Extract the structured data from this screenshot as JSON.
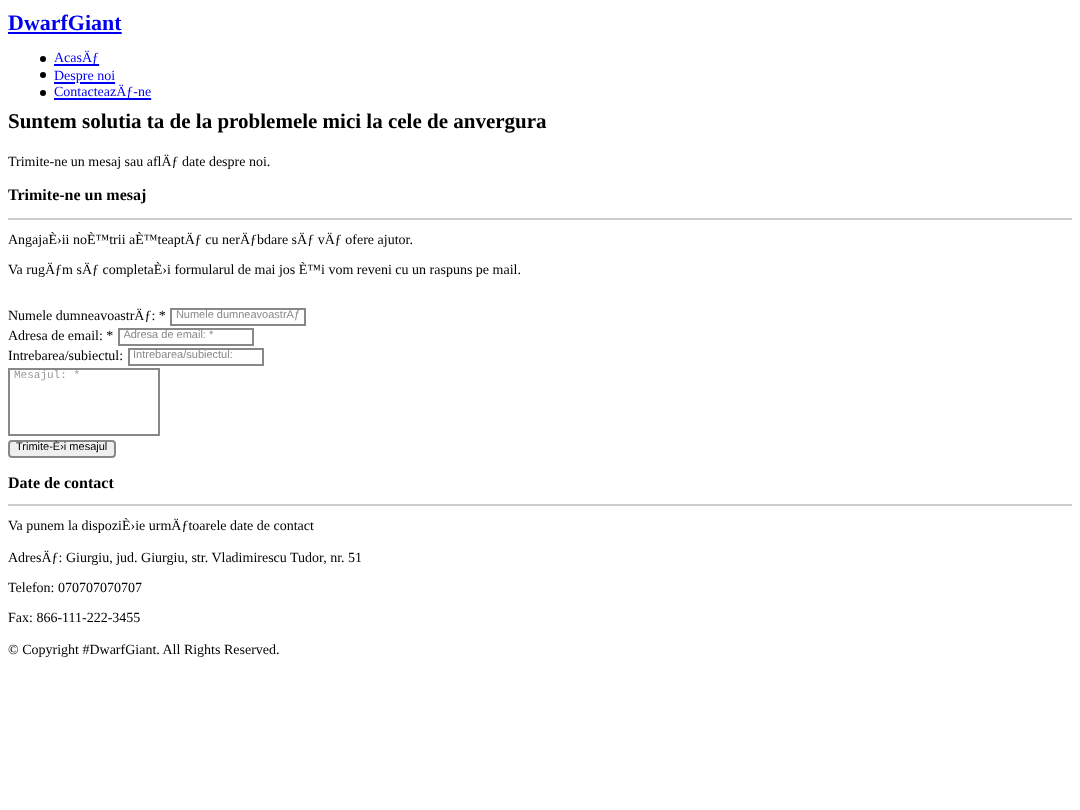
{
  "site_title": "DwarfGiant",
  "nav": [
    {
      "label": "AcasÄƒ"
    },
    {
      "label": "Despre noi"
    },
    {
      "label": "ContacteazÄƒ-ne"
    }
  ],
  "headline": "Suntem solutia ta de la problemele mici la cele de anvergura",
  "intro": "Trimite-ne un mesaj sau aflÄƒ date despre noi.",
  "message_section": {
    "heading": "Trimite-ne un mesaj",
    "paragraphs": [
      "AngajaÈ›ii noÈ™trii aÈ™teaptÄƒ cu nerÄƒbdare sÄƒ vÄƒ ofere ajutor.",
      "Va rugÄƒm sÄƒ completaÈ›i formularul de mai jos È™i vom reveni cu un raspuns pe mail."
    ]
  },
  "form": {
    "fields": [
      {
        "kind": "text",
        "label": "Numele dumneavoastrÄƒ: *",
        "placeholder": "Numele dumneavoastrÄƒ"
      },
      {
        "kind": "text",
        "label": "Adresa de email: *",
        "placeholder": "Adresa de email: *"
      },
      {
        "kind": "text",
        "label": "Intrebarea/subiectul:",
        "placeholder": "Intrebarea/subiectul:"
      },
      {
        "kind": "textarea",
        "placeholder": "Mesajul: *"
      }
    ],
    "submit": "Trimite-È›i mesajul"
  },
  "contact_section": {
    "heading": "Date de contact",
    "lines": [
      "Va punem la dispoziÈ›ie urmÄƒtoarele date de contact",
      "AdresÄƒ: Giurgiu, jud. Giurgiu, str. Vladimirescu Tudor, nr. 51",
      "Telefon: 070707070707",
      "Fax: 866-111-222-3455"
    ]
  },
  "footer": "© Copyright #DwarfGiant. All Rights Reserved."
}
